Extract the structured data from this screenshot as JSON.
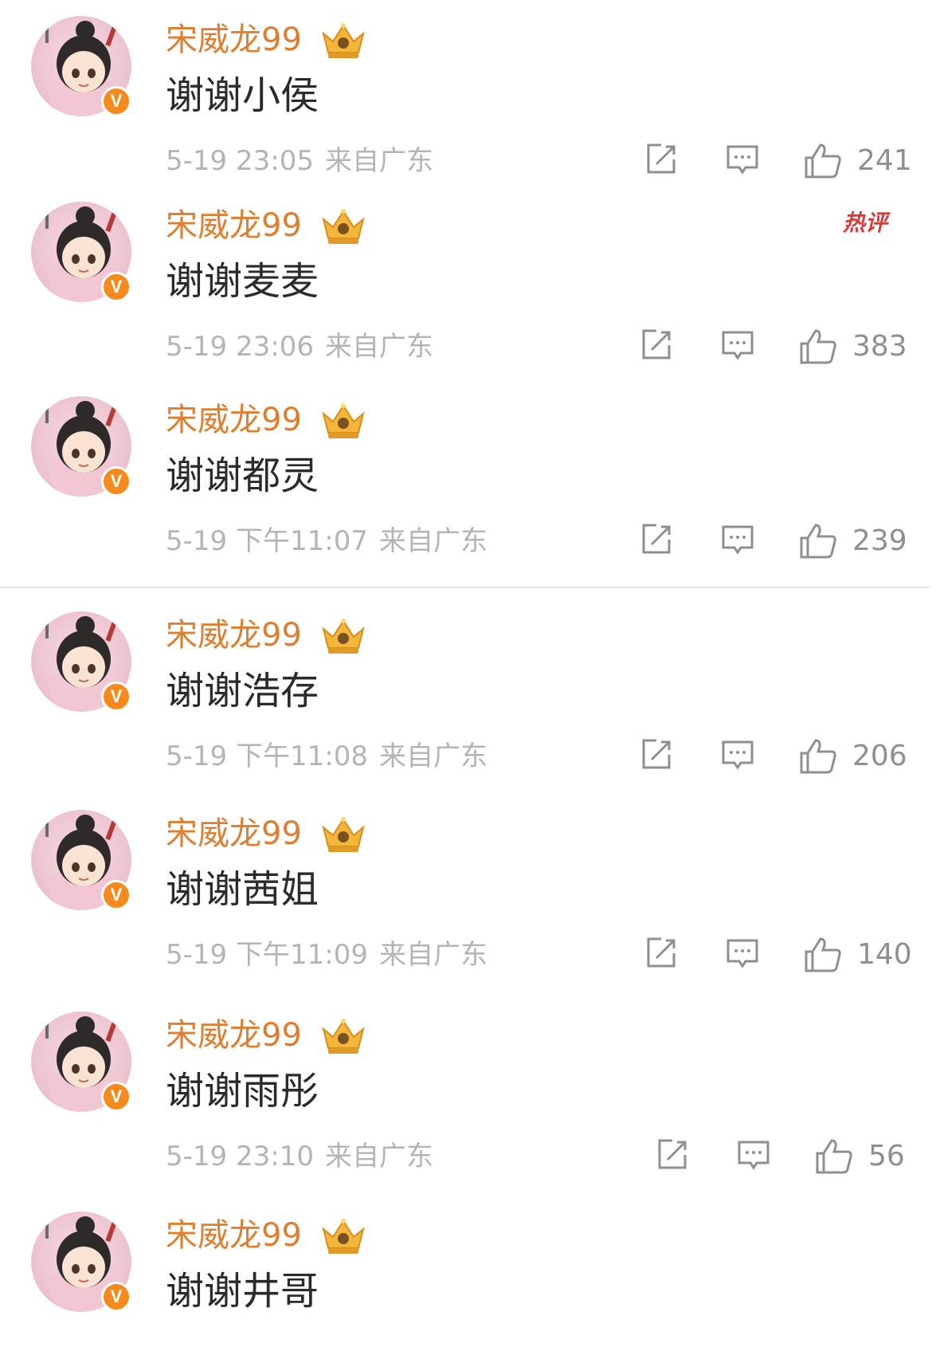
{
  "comments": [
    {
      "user": "宋威龙99",
      "text": "谢谢小侯",
      "time": "5-19 23:05",
      "source": "来自广东",
      "likes": "241"
    },
    {
      "user": "宋威龙99",
      "text": "谢谢麦麦",
      "time": "5-19 23:06",
      "source": "来自广东",
      "likes": "383",
      "badge": "热评"
    },
    {
      "user": "宋威龙99",
      "text": "谢谢都灵",
      "time": "5-19 下午11:07",
      "source": "来自广东",
      "likes": "239"
    },
    {
      "user": "宋威龙99",
      "text": "谢谢浩存",
      "time": "5-19 下午11:08",
      "source": "来自广东",
      "likes": "206"
    },
    {
      "user": "宋威龙99",
      "text": "谢谢茜姐",
      "time": "5-19 下午11:09",
      "source": "来自广东",
      "likes": "140"
    },
    {
      "user": "宋威龙99",
      "text": "谢谢雨彤",
      "time": "5-19 23:10",
      "source": "来自广东",
      "likes": "56"
    },
    {
      "user": "宋威龙99",
      "text": "谢谢井哥",
      "time": "",
      "source": "",
      "likes": ""
    }
  ],
  "verified_badge": "V",
  "icons": {
    "repost": "repost-icon",
    "comment": "comment-icon",
    "like": "thumbs-up-icon",
    "crown": "crown-icon"
  },
  "colors": {
    "username": "#e07e2f",
    "verified": "#f78a1c",
    "hot_badge": "#d93b3b",
    "meta": "#b4b4b4"
  }
}
